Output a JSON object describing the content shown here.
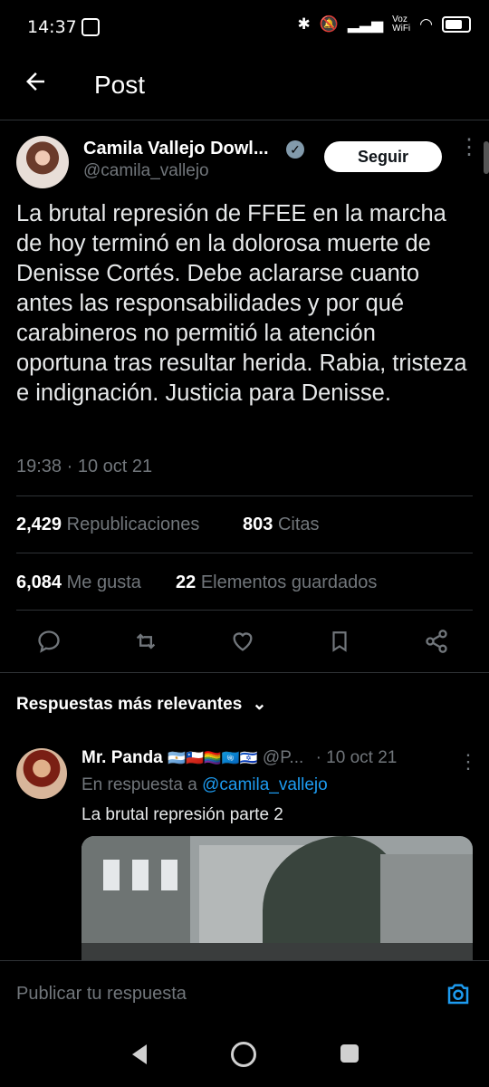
{
  "status": {
    "time": "14:37",
    "net": "Voz\nWiFi",
    "battery_icon": "battery-icon"
  },
  "header": {
    "title": "Post"
  },
  "tweet": {
    "author_name": "Camila Vallejo Dowl...",
    "handle": "@camila_vallejo",
    "follow_label": "Seguir",
    "text": "La brutal represión de FFEE en la marcha de hoy terminó en la dolorosa muerte de Denisse Cortés. Debe aclararse cuanto antes las responsabilidades y por qué carabineros no permitió la atención oportuna tras resultar herida. Rabia, tristeza e indignación. Justicia para Denisse.",
    "timestamp": "19:38 · 10 oct 21",
    "reposts": "2,429",
    "reposts_label": "Republicaciones",
    "quotes": "803",
    "quotes_label": "Citas",
    "likes": "6,084",
    "likes_label": "Me gusta",
    "bookmarks": "22",
    "bookmarks_label": "Elementos guardados"
  },
  "replies_sort": {
    "label": "Respuestas más relevantes"
  },
  "reply": {
    "author_name": "Mr. Panda",
    "flags": "🇦🇷🇨🇱🏳️‍🌈🇺🇳🇮🇱",
    "handle": "@P...",
    "date": "· 10 oct 21",
    "in_reply_prefix": "En respuesta a",
    "in_reply_handle": "@camila_vallejo",
    "text": "La brutal represión parte 2"
  },
  "composer": {
    "placeholder": "Publicar tu respuesta"
  },
  "colors": {
    "accent": "#1d9bf0",
    "verified": "#829aab"
  }
}
